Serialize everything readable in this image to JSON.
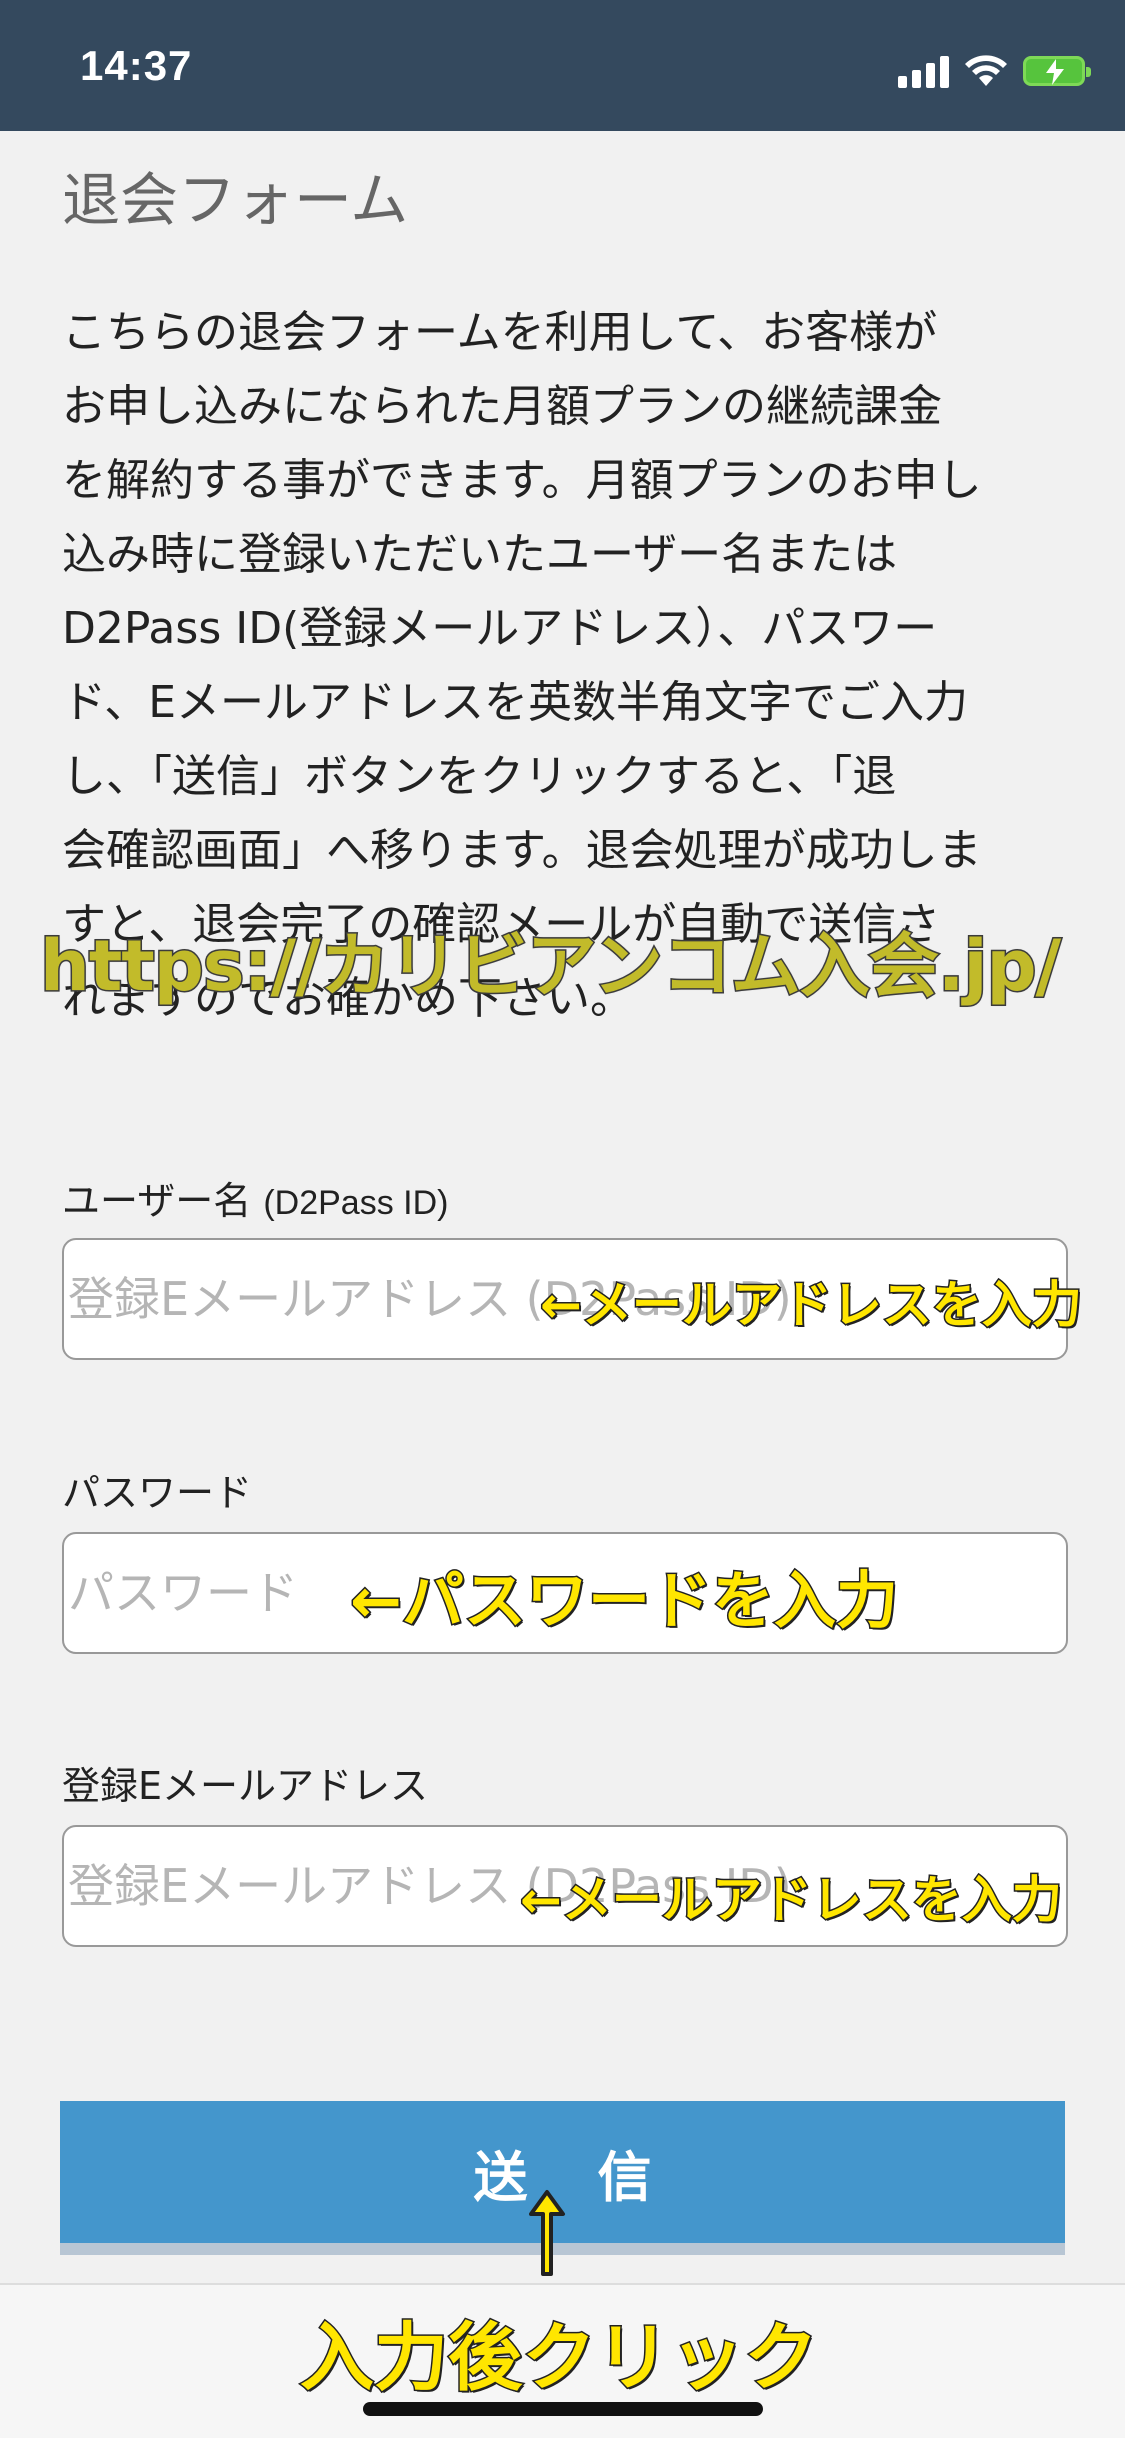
{
  "status_bar": {
    "time": "14:37",
    "icons": [
      "signal-icon",
      "wifi-icon",
      "battery-charging-icon"
    ],
    "battery_color": "#56c43d"
  },
  "page": {
    "title": "退会フォーム",
    "description_lines": [
      "こちらの退会フォームを利用して、お客様が",
      "お申し込みになられた月額プランの継続課金",
      "を解約する事ができます。月額プランのお申し",
      "込み時に登録いただいたユーザー名または",
      "D2Pass ID(登録メールアドレス）、パスワー",
      "ド、Eメールアドレスを英数半角文字でご入力",
      "し、「送信」ボタンをクリックすると、「退",
      "会確認画面」へ移ります。退会処理が成功しま",
      "すと、退会完了の確認メールが自動で送信さ",
      "れますのでお確かめ下さい。"
    ]
  },
  "overlay_url": "https://カリビアンコム入会.jp/",
  "form": {
    "username": {
      "label": "ユーザー名",
      "label_sub": "(D2Pass ID)",
      "placeholder": "登録Eメールアドレス (D2Pass ID)",
      "annotation": "←メールアドレスを入力"
    },
    "password": {
      "label": "パスワード",
      "placeholder": "パスワード",
      "annotation": "←パスワードを入力"
    },
    "email": {
      "label": "登録Eメールアドレス",
      "placeholder": "登録Eメールアドレス (D2Pass ID)",
      "annotation": "←メールアドレスを入力"
    },
    "submit_label": "送信",
    "submit_color": "#4496cc",
    "submit_annotation": "入力後クリック"
  },
  "annotation_color": "#ffe600"
}
